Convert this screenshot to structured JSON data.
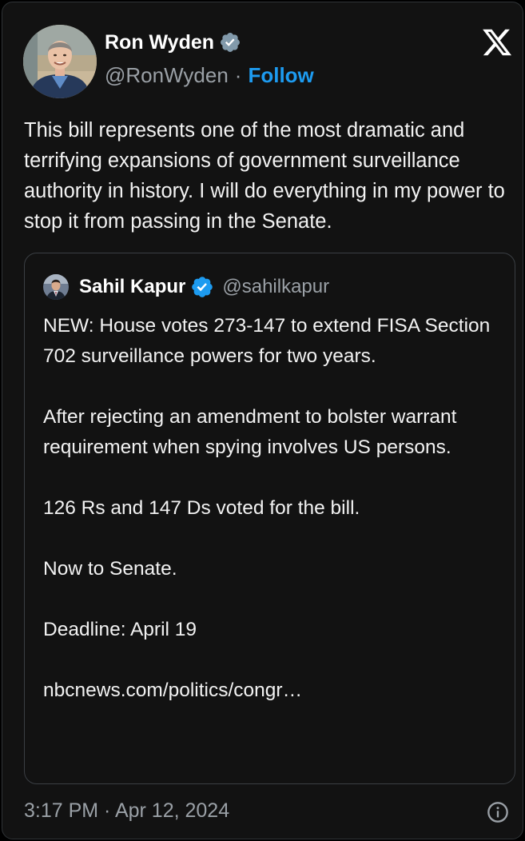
{
  "tweet": {
    "author": {
      "name": "Ron Wyden",
      "handle": "@RonWyden",
      "separator": "·",
      "follow_label": "Follow"
    },
    "text": "This bill represents one of the most dramatic and terrifying expansions of government surveillance authority in history. I will do everything in my power to stop it from passing in the Senate.",
    "timestamp": "3:17 PM · Apr 12, 2024"
  },
  "quoted_tweet": {
    "author": {
      "name": "Sahil Kapur",
      "handle": "@sahilkapur"
    },
    "paragraphs": [
      "NEW: House votes 273-147 to extend FISA Section 702 surveillance powers for two years.",
      "After rejecting an amendment to bolster warrant requirement when spying involves US persons.",
      "126 Rs and 147 Ds voted for the bill.",
      "Now to Senate.",
      "Deadline: April 19",
      "nbcnews.com/politics/congr…"
    ]
  },
  "icons": {
    "platform_logo": "x-logo-icon",
    "author_badge": "verified-gray-badge-icon",
    "quoted_badge": "verified-blue-badge-icon",
    "info": "info-icon"
  },
  "colors": {
    "background": "#121212",
    "accent": "#1d9bf0",
    "secondary_text": "#9aa0a6",
    "primary_text": "#f2f2f2"
  }
}
